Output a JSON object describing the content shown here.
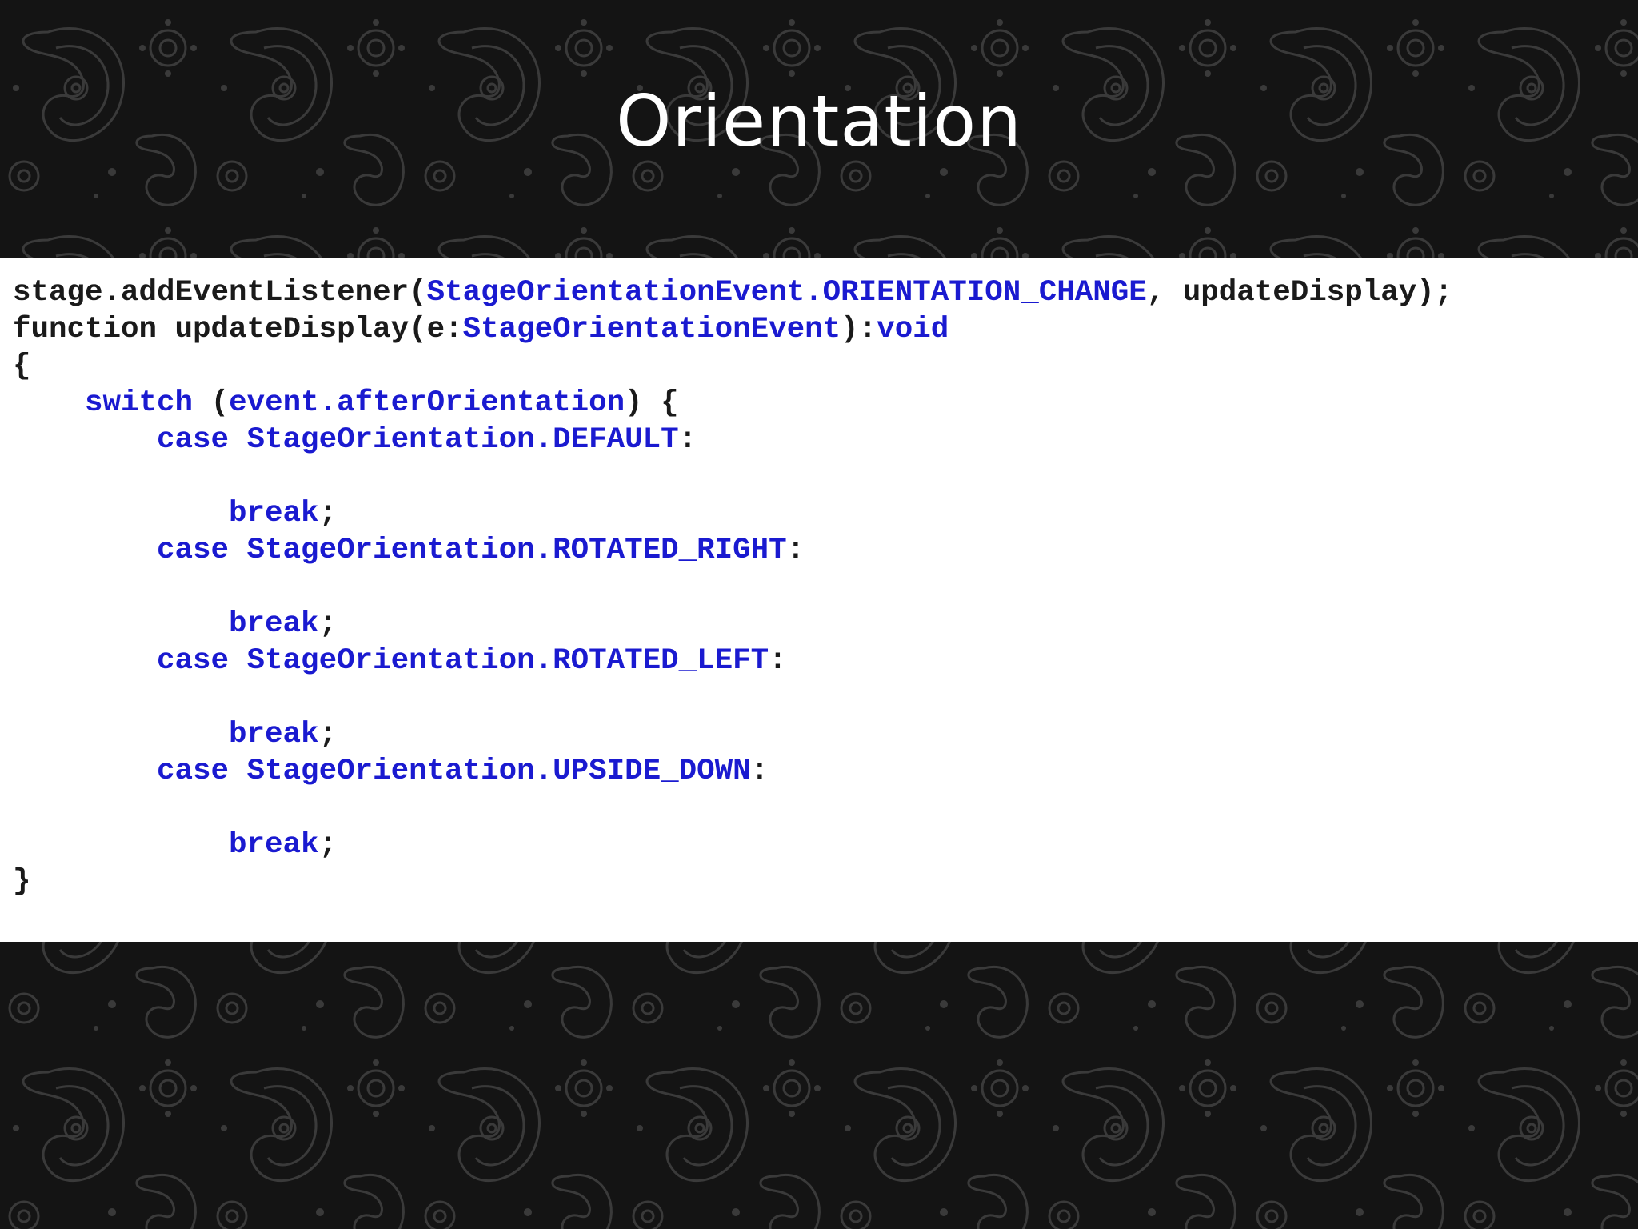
{
  "slide": {
    "title": "Orientation"
  },
  "code": {
    "lines": [
      [
        {
          "text": "stage.addEventListener(",
          "color": "black"
        },
        {
          "text": "StageOrientationEvent.ORIENTATION_CHANGE",
          "color": "blue"
        },
        {
          "text": ", updateDisplay);",
          "color": "black"
        }
      ],
      [
        {
          "text": "function updateDisplay(e:",
          "color": "black"
        },
        {
          "text": "StageOrientationEvent",
          "color": "blue"
        },
        {
          "text": "):",
          "color": "black"
        },
        {
          "text": "void",
          "color": "blue"
        }
      ],
      [
        {
          "text": "{",
          "color": "black"
        }
      ],
      [
        {
          "text": "    ",
          "color": "black"
        },
        {
          "text": "switch",
          "color": "blue"
        },
        {
          "text": " (",
          "color": "black"
        },
        {
          "text": "event.afterOrientation",
          "color": "blue"
        },
        {
          "text": ") {",
          "color": "black"
        }
      ],
      [
        {
          "text": "        ",
          "color": "black"
        },
        {
          "text": "case StageOrientation.DEFAULT",
          "color": "blue"
        },
        {
          "text": ":",
          "color": "black"
        }
      ],
      [],
      [
        {
          "text": "            ",
          "color": "black"
        },
        {
          "text": "break",
          "color": "blue"
        },
        {
          "text": ";",
          "color": "black"
        }
      ],
      [
        {
          "text": "        ",
          "color": "black"
        },
        {
          "text": "case StageOrientation.ROTATED_RIGHT",
          "color": "blue"
        },
        {
          "text": ":",
          "color": "black"
        }
      ],
      [],
      [
        {
          "text": "            ",
          "color": "black"
        },
        {
          "text": "break",
          "color": "blue"
        },
        {
          "text": ";",
          "color": "black"
        }
      ],
      [
        {
          "text": "        ",
          "color": "black"
        },
        {
          "text": "case StageOrientation.ROTATED_LEFT",
          "color": "blue"
        },
        {
          "text": ":",
          "color": "black"
        }
      ],
      [],
      [
        {
          "text": "            ",
          "color": "black"
        },
        {
          "text": "break",
          "color": "blue"
        },
        {
          "text": ";",
          "color": "black"
        }
      ],
      [
        {
          "text": "        ",
          "color": "black"
        },
        {
          "text": "case StageOrientation.UPSIDE_DOWN",
          "color": "blue"
        },
        {
          "text": ":",
          "color": "black"
        }
      ],
      [],
      [
        {
          "text": "            ",
          "color": "black"
        },
        {
          "text": "break",
          "color": "blue"
        },
        {
          "text": ";",
          "color": "black"
        }
      ],
      [
        {
          "text": "}",
          "color": "black"
        }
      ]
    ]
  },
  "colors": {
    "background": "#141414",
    "pattern": "#3a3a3a",
    "title": "#ffffff",
    "code_panel": "#ffffff",
    "code_black": "#1a1a1a",
    "code_blue": "#1a1ad0"
  }
}
